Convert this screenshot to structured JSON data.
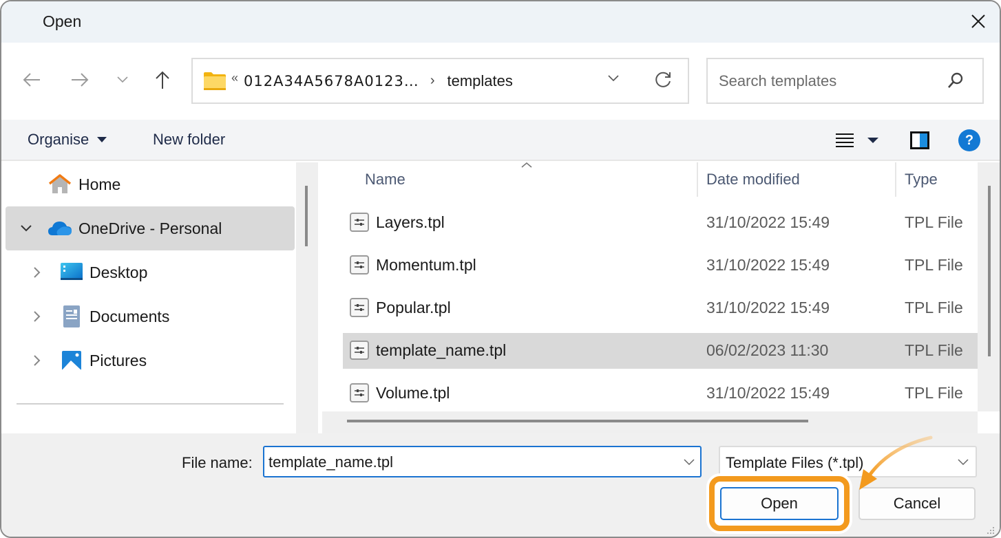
{
  "window": {
    "title": "Open",
    "close_label": "Close"
  },
  "nav": {
    "back_icon": "arrow-left-icon",
    "forward_icon": "arrow-right-icon",
    "recent_icon": "chevron-down-icon",
    "up_icon": "arrow-up-icon",
    "address": {
      "overflow_marker": "«",
      "crumbs": [
        "012A34A5678A0123…",
        "templates"
      ],
      "separator": "›"
    },
    "search_placeholder": "Search templates"
  },
  "commandbar": {
    "organise_label": "Organise",
    "new_folder_label": "New folder",
    "view_icon": "list-view-icon",
    "preview_icon": "preview-pane-icon",
    "help_label": "?"
  },
  "sidebar": {
    "items": [
      {
        "label": "Home",
        "icon": "home-icon",
        "expander": "",
        "selected": false
      },
      {
        "label": "OneDrive - Personal",
        "icon": "onedrive-cloud-icon",
        "expander": "expanded",
        "selected": true
      },
      {
        "label": "Desktop",
        "icon": "desktop-folder-icon",
        "expander": "collapsed",
        "selected": false
      },
      {
        "label": "Documents",
        "icon": "documents-folder-icon",
        "expander": "collapsed",
        "selected": false
      },
      {
        "label": "Pictures",
        "icon": "pictures-folder-icon",
        "expander": "collapsed",
        "selected": false
      }
    ]
  },
  "filelist": {
    "columns": {
      "name": "Name",
      "date": "Date modified",
      "type": "Type"
    },
    "sort_column": "name",
    "rows": [
      {
        "name": "Layers.tpl",
        "date": "31/10/2022 15:49",
        "type": "TPL File",
        "selected": false
      },
      {
        "name": "Momentum.tpl",
        "date": "31/10/2022 15:49",
        "type": "TPL File",
        "selected": false
      },
      {
        "name": "Popular.tpl",
        "date": "31/10/2022 15:49",
        "type": "TPL File",
        "selected": false
      },
      {
        "name": "template_name.tpl",
        "date": "06/02/2023 11:30",
        "type": "TPL File",
        "selected": true
      },
      {
        "name": "Volume.tpl",
        "date": "31/10/2022 15:49",
        "type": "TPL File",
        "selected": false
      }
    ]
  },
  "footer": {
    "file_name_label": "File name:",
    "file_name_value": "template_name.tpl",
    "file_type_value": "Template Files (*.tpl)",
    "open_label": "Open",
    "cancel_label": "Cancel"
  },
  "annotation": {
    "highlight_color": "#f39a1e",
    "target": "open-button"
  }
}
